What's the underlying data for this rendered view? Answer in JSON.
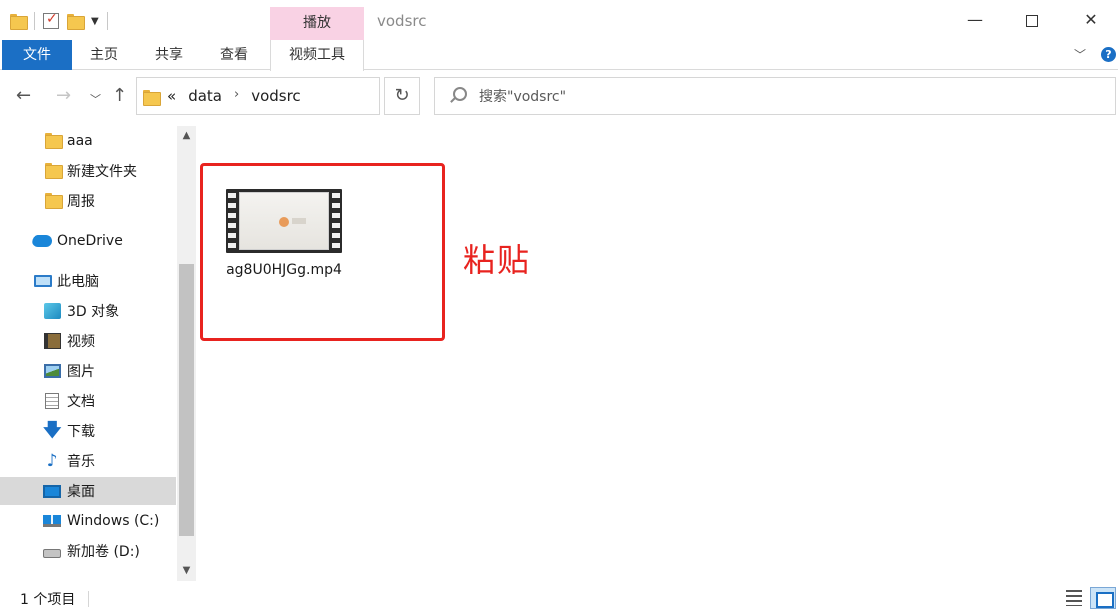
{
  "window": {
    "title": "vodsrc",
    "context_tab_header": "播放",
    "minimize_glyph": "—",
    "close_glyph": "✕"
  },
  "ribbon": {
    "tabs": [
      {
        "label": "文件"
      },
      {
        "label": "主页"
      },
      {
        "label": "共享"
      },
      {
        "label": "查看"
      },
      {
        "label": "视频工具"
      }
    ],
    "expand_glyph": "﹀",
    "help_glyph": "?"
  },
  "address": {
    "overflow_glyph": "«",
    "crumbs": [
      "data",
      "vodsrc"
    ],
    "crumb_separator": "›"
  },
  "search": {
    "placeholder": "搜索\"vodsrc\""
  },
  "sidebar": {
    "items": [
      {
        "label": "aaa",
        "icon": "folder-icon"
      },
      {
        "label": "新建文件夹",
        "icon": "folder-icon"
      },
      {
        "label": "周报",
        "icon": "folder-icon"
      },
      {
        "label": "OneDrive",
        "icon": "onedrive-icon"
      },
      {
        "label": "此电脑",
        "icon": "this-pc-icon"
      },
      {
        "label": "3D 对象",
        "icon": "3d-objects-icon"
      },
      {
        "label": "视频",
        "icon": "videos-icon"
      },
      {
        "label": "图片",
        "icon": "pictures-icon"
      },
      {
        "label": "文档",
        "icon": "documents-icon"
      },
      {
        "label": "下载",
        "icon": "downloads-icon"
      },
      {
        "label": "音乐",
        "icon": "music-icon"
      },
      {
        "label": "桌面",
        "icon": "desktop-icon",
        "selected": true
      },
      {
        "label": "Windows (C:)",
        "icon": "windows-drive-icon"
      },
      {
        "label": "新加卷 (D:)",
        "icon": "drive-icon"
      }
    ]
  },
  "content": {
    "files": [
      {
        "name": "ag8U0HJGg.mp4",
        "icon": "video-file-icon"
      }
    ],
    "annotation": "粘贴",
    "annotation_color": "#e8231f"
  },
  "status": {
    "item_count": "1 个项目"
  },
  "colors": {
    "file_tab": "#1b6fc5",
    "context_tab": "#f9d2e4",
    "selected_nav": "#d9d9d9"
  }
}
